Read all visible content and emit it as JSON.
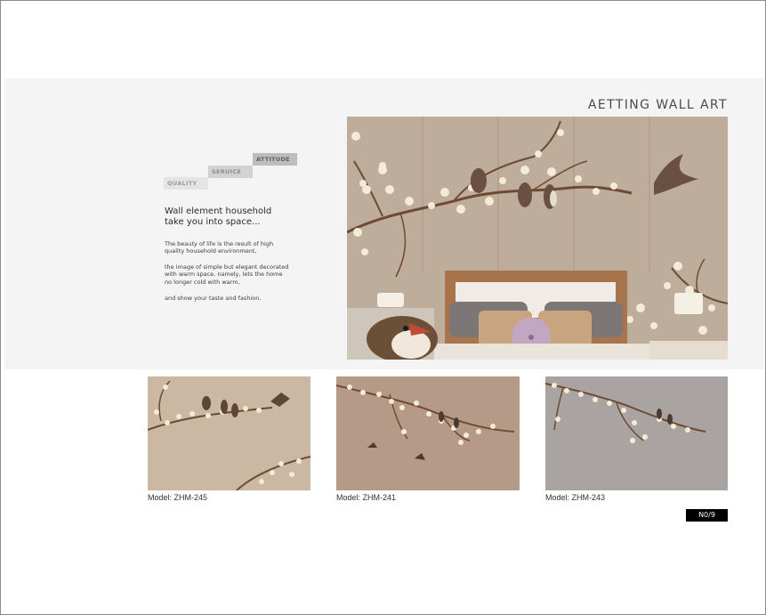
{
  "steps": {
    "quality": "QUALITY",
    "service": "SERUICE",
    "attitude": "ATTITUDE"
  },
  "headline_1": "Wall element household",
  "headline_2": "take you into space...",
  "paragraphs": {
    "p1_line1": "The beauty of life is the result of high",
    "p1_line2": "quality household environment,",
    "p2_line1": "the image of simple but elegant decorated",
    "p2_line2": "with warm space, namely, lets the home",
    "p2_line3": "no longer cold with warm,",
    "p3_line1": "and show your taste and fashion."
  },
  "brand_title": "AETTING WALL ART",
  "products": [
    {
      "caption": "Model:  ZHM-245",
      "bg": "#cbb8a2"
    },
    {
      "caption": "Model:  ZHM-241",
      "bg": "#b59a87"
    },
    {
      "caption": "Model:  ZHM-243",
      "bg": "#a9a4a1"
    }
  ],
  "page_number": "N0/9",
  "colors": {
    "band": "#f4f4f4",
    "wall": "#bfad9b",
    "branch": "#6e4a35",
    "blossom": "#f3ebd7"
  }
}
